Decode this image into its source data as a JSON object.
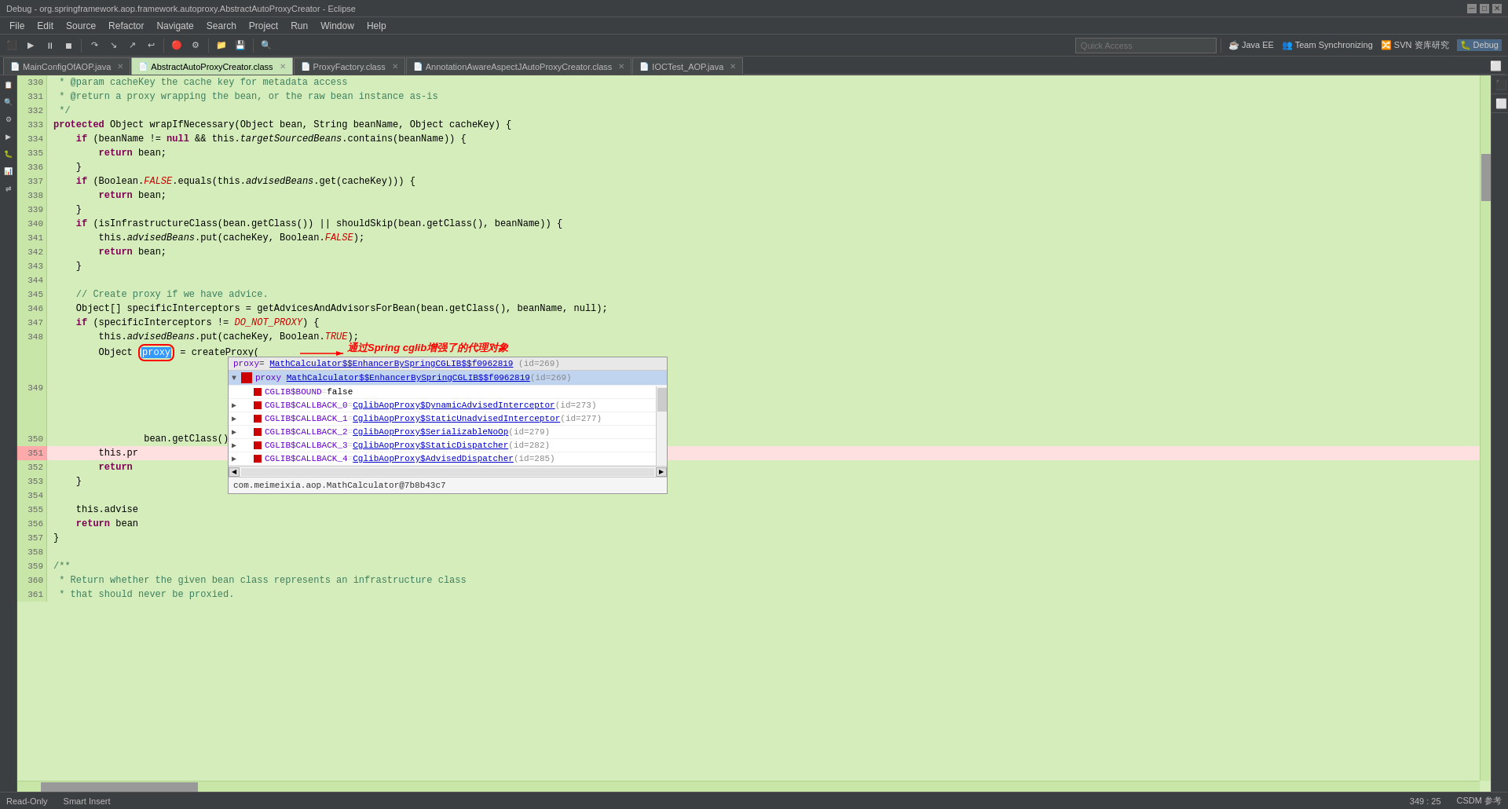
{
  "titleBar": {
    "title": "Debug - org.springframework.aop.framework.autoproxy.AbstractAutoProxyCreator - Eclipse",
    "controls": [
      "_",
      "□",
      "✕"
    ]
  },
  "menuBar": {
    "items": [
      "File",
      "Edit",
      "Source",
      "Refactor",
      "Navigate",
      "Search",
      "Project",
      "Run",
      "Window",
      "Help"
    ]
  },
  "toolbar": {
    "quickAccess": {
      "label": "Quick Access",
      "placeholder": "Quick Access"
    }
  },
  "perspectives": {
    "items": [
      "Java EE",
      "Team Synchronizing",
      "SVN 资库研究",
      "Debug"
    ]
  },
  "tabs": [
    {
      "label": "MainConfigOfAOP.java",
      "active": false
    },
    {
      "label": "AbstractAutoProxyCreator.class",
      "active": true
    },
    {
      "label": "ProxyFactory.class",
      "active": false
    },
    {
      "label": "AnnotationAwareAspectJAutoProxyCreator.class",
      "active": false
    },
    {
      "label": "IOCTest_AOP.java",
      "active": false
    }
  ],
  "codeLines": [
    {
      "num": "330",
      "content": " * @param cacheKey the cache key for metadata access"
    },
    {
      "num": "331",
      "content": " * @return a proxy wrapping the bean, or the raw bean instance as-is"
    },
    {
      "num": "332",
      "content": " */"
    },
    {
      "num": "333",
      "content": "protected Object wrapIfNecessary(Object bean, String beanName, Object cacheKey) {"
    },
    {
      "num": "334",
      "content": "    if (beanName != null && this.targetSourcedBeans.contains(beanName)) {"
    },
    {
      "num": "335",
      "content": "        return bean;"
    },
    {
      "num": "336",
      "content": "    }"
    },
    {
      "num": "337",
      "content": "    if (Boolean.FALSE.equals(this.advisedBeans.get(cacheKey))) {"
    },
    {
      "num": "338",
      "content": "        return bean;"
    },
    {
      "num": "339",
      "content": "    }"
    },
    {
      "num": "340",
      "content": "    if (isInfrastructureClass(bean.getClass()) || shouldSkip(bean.getClass(), beanName)) {"
    },
    {
      "num": "341",
      "content": "        this.advisedBeans.put(cacheKey, Boolean.FALSE);"
    },
    {
      "num": "342",
      "content": "        return bean;"
    },
    {
      "num": "343",
      "content": "    }"
    },
    {
      "num": "344",
      "content": ""
    },
    {
      "num": "345",
      "content": "    // Create proxy if we have advice."
    },
    {
      "num": "346",
      "content": "    Object[] specificInterceptors = getAdvicesAndAdvisorsForBean(bean.getClass(), beanName, null);"
    },
    {
      "num": "347",
      "content": "    if (specificInterceptors != DO_NOT_PROXY) {"
    },
    {
      "num": "348",
      "content": "        this.advisedBeans.put(cacheKey, Boolean.TRUE);"
    },
    {
      "num": "349",
      "content": "        Object proxy = createProxy("
    },
    {
      "num": "350",
      "content": "                bean.getClass(), beanName, specificInterceptors, new SingletonTargetSource(bean));"
    },
    {
      "num": "351",
      "content": "        this.pr"
    },
    {
      "num": "352",
      "content": "        return"
    },
    {
      "num": "353",
      "content": "    }"
    },
    {
      "num": "354",
      "content": ""
    },
    {
      "num": "355",
      "content": "    this.advise"
    },
    {
      "num": "356",
      "content": "    return bean"
    },
    {
      "num": "357",
      "content": "}"
    },
    {
      "num": "358",
      "content": ""
    },
    {
      "num": "359",
      "content": "/**"
    },
    {
      "num": "360",
      "content": " * Return whether the given bean class represents an infrastructure class"
    },
    {
      "num": "361",
      "content": " * that should never be proxied."
    }
  ],
  "debugPopup": {
    "title": "proxy= MathCalculator$$EnhancerBySpringCGLIB$$f0962819  (id=269)",
    "rows": [
      {
        "indent": 0,
        "expanded": true,
        "type": "header",
        "name": "proxy",
        "eq": "= ",
        "value": "MathCalculator$$EnhancerBySpringCGLIB$$f0962819",
        "id": "(id=269)"
      },
      {
        "indent": 1,
        "type": "field",
        "name": "CGLIB$BOUND",
        "eq": "= ",
        "value": "false",
        "id": ""
      },
      {
        "indent": 1,
        "type": "field",
        "name": "CGLIB$CALLBACK_0",
        "eq": "= ",
        "value": "CglibAopProxy$DynamicAdvisedInterceptor",
        "id": "(id=273)"
      },
      {
        "indent": 1,
        "type": "field",
        "name": "CGLIB$CALLBACK_1",
        "eq": "= ",
        "value": "CglibAopProxy$StaticUnadvisedInterceptor",
        "id": "(id=277)"
      },
      {
        "indent": 1,
        "type": "field",
        "name": "CGLIB$CALLBACK_2",
        "eq": "= ",
        "value": "CglibAopProxy$SerializableNoOp",
        "id": "(id=279)"
      },
      {
        "indent": 1,
        "type": "field",
        "name": "CGLIB$CALLBACK_3",
        "eq": "= ",
        "value": "CglibAopProxy$StaticDispatcher",
        "id": "(id=282)"
      },
      {
        "indent": 1,
        "type": "field",
        "name": "CGLIB$CALLBACK_4",
        "eq": "= ",
        "value": "CglibAopProxy$AdvisedDispatcher",
        "id": "(id=285)"
      }
    ],
    "footer": "com.meimeixia.aop.MathCalculator@7b8b43c7"
  },
  "annotation": {
    "text": "通过Spring cglib增强了的代理对象"
  },
  "statusBar": {
    "readOnly": "Read-Only",
    "insertMode": "Smart Insert",
    "position": "349 : 25",
    "right": "CSDM 参考"
  }
}
